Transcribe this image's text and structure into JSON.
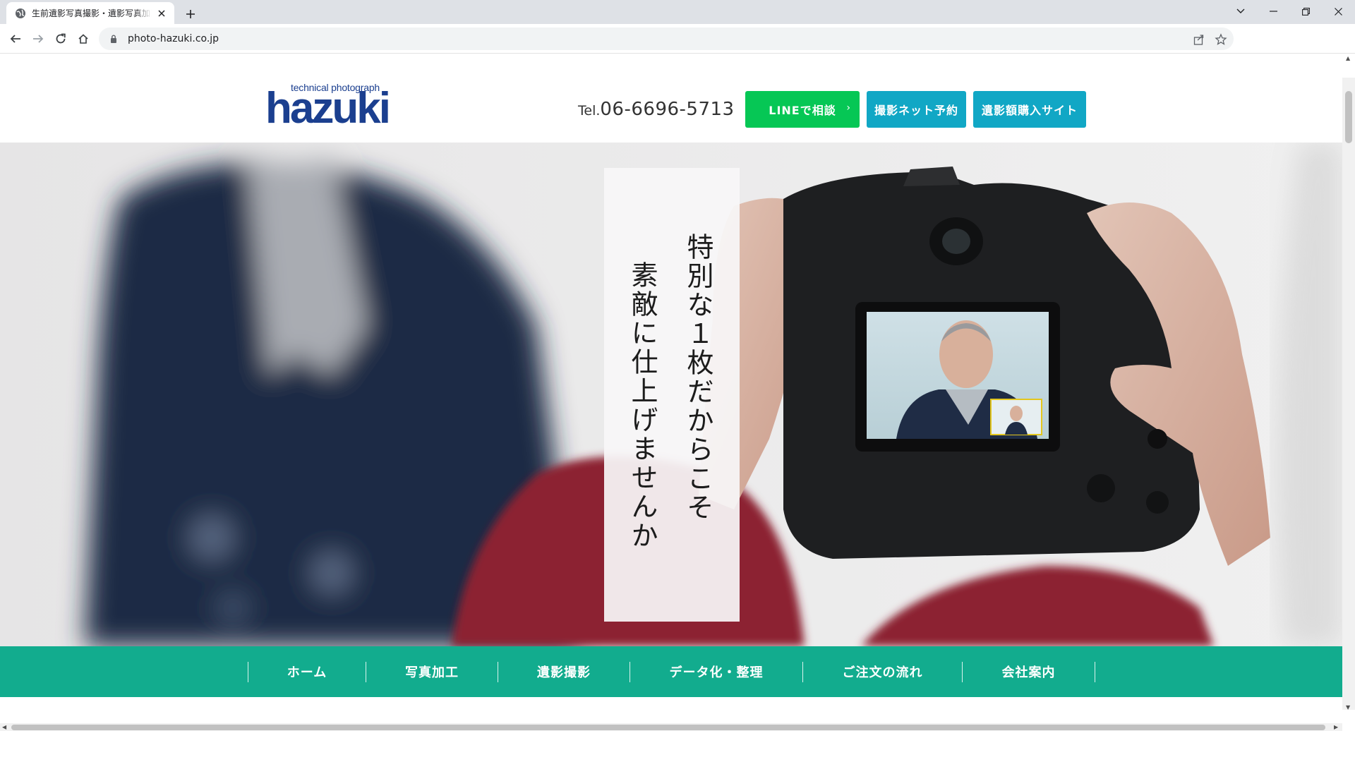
{
  "browser": {
    "tab_title": "生前遺影写真撮影・遺影写真加工",
    "url": "photo-hazuki.co.jp"
  },
  "header": {
    "logo_sub": "technical photograph",
    "logo_main": "hazuki",
    "tel_prefix": "Tel.",
    "tel_number": "06-6696-5713",
    "btn_line": "LINEで相談",
    "btn_net": "撮影ネット予約",
    "btn_buy": "遺影額購入サイト"
  },
  "hero": {
    "line1": "特別な１枚だからこそ",
    "line2": "素敵に仕上げませんか"
  },
  "nav": {
    "items": [
      "ホーム",
      "写真加工",
      "遺影撮影",
      "データ化・整理",
      "ご注文の流れ",
      "会社案内"
    ]
  },
  "colors": {
    "brand_blue": "#1b3f8f",
    "line_green": "#06c755",
    "cyan": "#11a7c5",
    "nav_teal": "#12ac8e"
  }
}
